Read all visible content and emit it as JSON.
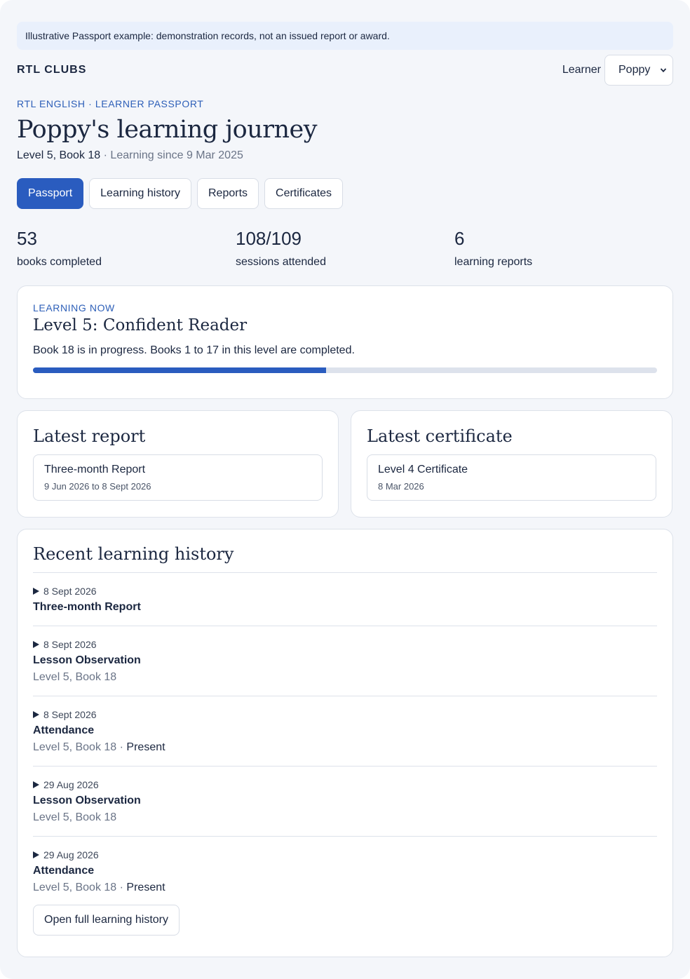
{
  "notice": "Illustrative Passport example: demonstration records, not an issued report or award.",
  "brand": "RTL CLUBS",
  "learner": {
    "label": "Learner",
    "selected": "Poppy"
  },
  "eyebrow": "RTL ENGLISH · LEARNER PASSPORT",
  "title": "Poppy's learning journey",
  "subline": {
    "level": "Level 5, Book 18",
    "since": " · Learning since 9 Mar 2025"
  },
  "tabs": [
    "Passport",
    "Learning history",
    "Reports",
    "Certificates"
  ],
  "stats": [
    {
      "value": "53",
      "label": "books completed"
    },
    {
      "value": "108/109",
      "label": "sessions attended"
    },
    {
      "value": "6",
      "label": "learning reports"
    }
  ],
  "learning_now": {
    "eyebrow": "LEARNING NOW",
    "title": "Level 5: Confident Reader",
    "description": "Book 18 is in progress. Books 1 to 17 in this level are completed.",
    "progress": 0.47
  },
  "latest_report": {
    "heading": "Latest report",
    "name": "Three-month Report",
    "date": "9 Jun 2026 to 8 Sept 2026"
  },
  "latest_certificate": {
    "heading": "Latest certificate",
    "name": "Level 4 Certificate",
    "date": "8 Mar 2026"
  },
  "history": {
    "heading": "Recent learning history",
    "items": [
      {
        "date": "8 Sept 2026",
        "type": "Three-month Report",
        "detail": "",
        "status": ""
      },
      {
        "date": "8 Sept 2026",
        "type": "Lesson Observation",
        "detail": "Level 5, Book 18",
        "status": ""
      },
      {
        "date": "8 Sept 2026",
        "type": "Attendance",
        "detail": "Level 5, Book 18",
        "status": "Present"
      },
      {
        "date": "29 Aug 2026",
        "type": "Lesson Observation",
        "detail": "Level 5, Book 18",
        "status": ""
      },
      {
        "date": "29 Aug 2026",
        "type": "Attendance",
        "detail": "Level 5, Book 18",
        "status": "Present"
      }
    ],
    "open_button": "Open full learning history"
  },
  "colors": {
    "accent": "#2a5cbf",
    "background": "#f4f6fa",
    "notice_bg": "#e9f0fc"
  }
}
